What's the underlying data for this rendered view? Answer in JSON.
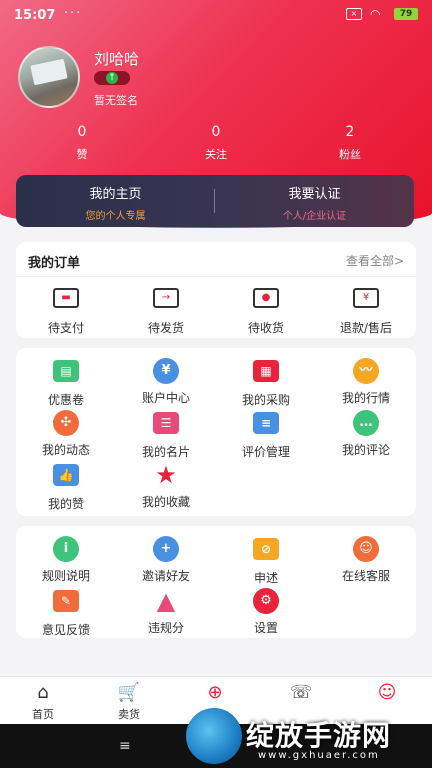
{
  "status": {
    "time": "15:07",
    "dots": "···",
    "battery": "79"
  },
  "profile": {
    "name": "刘哈哈",
    "signature": "暂无签名"
  },
  "stats": [
    {
      "value": "0",
      "label": "赞"
    },
    {
      "value": "0",
      "label": "关注"
    },
    {
      "value": "2",
      "label": "粉丝"
    }
  ],
  "home_card": {
    "left_title": "我的主页",
    "left_sub": "您的个人专属",
    "right_title": "我要认证",
    "right_sub": "个人/企业认证",
    "left_sub_color": "#f0a23c",
    "right_sub_color": "#f06a86"
  },
  "orders": {
    "title": "我的订单",
    "more": "查看全部>",
    "items": [
      {
        "label": "待支付",
        "icon": "wallet-icon"
      },
      {
        "label": "待发货",
        "icon": "box-send-icon"
      },
      {
        "label": "待收货",
        "icon": "truck-icon"
      },
      {
        "label": "退款/售后",
        "icon": "refund-icon"
      }
    ]
  },
  "tools": [
    {
      "label": "优惠卷",
      "icon": "coupon-icon",
      "color": "#3ec47a"
    },
    {
      "label": "账户中心",
      "icon": "account-icon",
      "color": "#4a90e2"
    },
    {
      "label": "我的采购",
      "icon": "basket-icon",
      "color": "#e8233b"
    },
    {
      "label": "我的行情",
      "icon": "trend-icon",
      "color": "#f5a623"
    },
    {
      "label": "我的动态",
      "icon": "pinwheel-icon",
      "color": "#f26b3a"
    },
    {
      "label": "我的名片",
      "icon": "card-icon",
      "color": "#e84a7a"
    },
    {
      "label": "评价管理",
      "icon": "comment-manage-icon",
      "color": "#4a90e2"
    },
    {
      "label": "我的评论",
      "icon": "chat-icon",
      "color": "#3ec47a"
    },
    {
      "label": "我的赞",
      "icon": "thumb-up-icon",
      "color": "#4a90e2"
    },
    {
      "label": "我的收藏",
      "icon": "star-icon",
      "color": "#e8233b"
    }
  ],
  "misc": [
    {
      "label": "规则说明",
      "icon": "info-icon",
      "color": "#3ec47a"
    },
    {
      "label": "邀请好友",
      "icon": "add-friend-icon",
      "color": "#4a90e2"
    },
    {
      "label": "申述",
      "icon": "appeal-icon",
      "color": "#f5a623"
    },
    {
      "label": "在线客服",
      "icon": "service-icon",
      "color": "#f26b3a"
    },
    {
      "label": "意见反馈",
      "icon": "feedback-icon",
      "color": "#f26b3a"
    },
    {
      "label": "违规分",
      "icon": "warning-icon",
      "color": "#e84a7a"
    },
    {
      "label": "设置",
      "icon": "gear-icon",
      "color": "#e8233b"
    }
  ],
  "tabbar": [
    {
      "label": "首页",
      "icon": "home-icon"
    },
    {
      "label": "卖货",
      "icon": "cart-icon"
    },
    {
      "label": "",
      "icon": "publish-icon"
    },
    {
      "label": "",
      "icon": "message-icon"
    },
    {
      "label": "",
      "icon": "smile-icon"
    }
  ],
  "watermark": {
    "text": "绽放手游网",
    "url": "www.gxhuaer.com"
  }
}
